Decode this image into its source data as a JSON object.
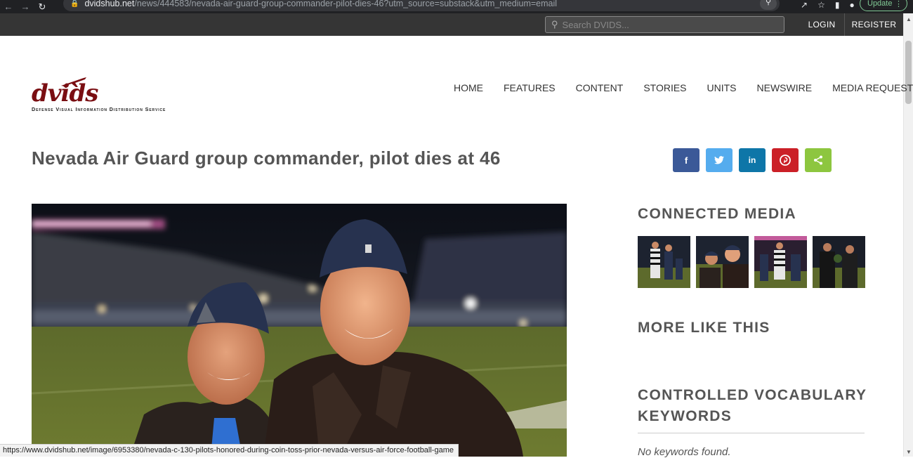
{
  "browser": {
    "url_domain": "dvidshub.net",
    "url_path": "/news/444583/nevada-air-guard-group-commander-pilot-dies-46?utm_source=substack&utm_medium=email",
    "update_label": "Update",
    "status_url": "https://www.dvidshub.net/image/6953380/nevada-c-130-pilots-honored-during-coin-toss-prior-nevada-versus-air-force-football-game"
  },
  "topbar": {
    "search_placeholder": "Search DVIDS...",
    "login": "LOGIN",
    "register": "REGISTER"
  },
  "logo": {
    "wordmark": "dvids",
    "tagline": "Defense Visual Information Distribution Service"
  },
  "nav": {
    "items": [
      "HOME",
      "FEATURES",
      "CONTENT",
      "STORIES",
      "UNITS",
      "NEWSWIRE",
      "MEDIA REQUESTS"
    ]
  },
  "article": {
    "title": "Nevada Air Guard group commander, pilot dies at 46"
  },
  "share": [
    {
      "icon": "facebook-icon",
      "glyph": "f",
      "color": "#3b5998"
    },
    {
      "icon": "twitter-icon",
      "glyph": "t",
      "color": "#55acee"
    },
    {
      "icon": "linkedin-icon",
      "glyph": "in",
      "color": "#0e76a8"
    },
    {
      "icon": "pinterest-icon",
      "glyph": "p",
      "color": "#cb2027"
    },
    {
      "icon": "share-icon",
      "glyph": "<",
      "color": "#8dc63f"
    }
  ],
  "sidebar": {
    "connected_media": "CONNECTED MEDIA",
    "more_like_this": "MORE LIKE THIS",
    "keywords_heading_1": "CONTROLLED VOCABULARY",
    "keywords_heading_2": "KEYWORDS",
    "no_keywords": "No keywords found."
  }
}
